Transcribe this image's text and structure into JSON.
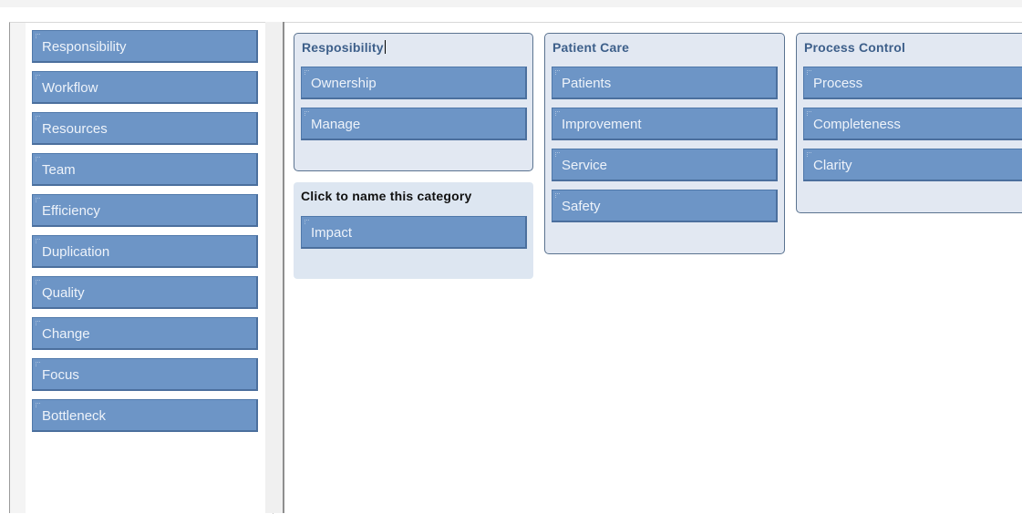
{
  "pool": {
    "cards": [
      "Responsibility",
      "Workflow",
      "Resources",
      "Team",
      "Efficiency",
      "Duplication",
      "Quality",
      "Change",
      "Focus",
      "Bottleneck"
    ]
  },
  "categories": [
    {
      "title": "Resposibility",
      "cards": [
        "Ownership",
        "Manage"
      ]
    },
    {
      "title": "Click to name this category",
      "cards": [
        "Impact"
      ]
    },
    {
      "title": "Patient Care",
      "cards": [
        "Patients",
        "Improvement",
        "Service",
        "Safety"
      ]
    },
    {
      "title": "Process Control",
      "cards": [
        "Process",
        "Completeness",
        "Clarity"
      ]
    }
  ],
  "colors": {
    "card": "#6d95c6",
    "category_bg": "#e2e8f2",
    "category_title": "#3d5f8a"
  }
}
